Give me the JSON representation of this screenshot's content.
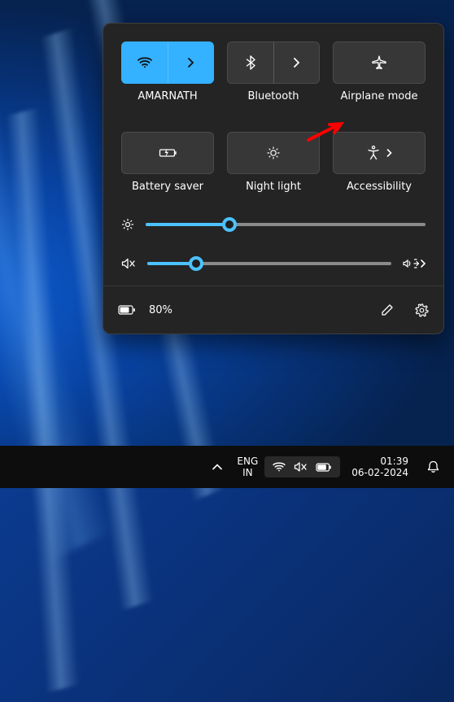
{
  "quick_settings": {
    "tiles": [
      {
        "key": "wifi",
        "label": "AMARNATH",
        "active": true,
        "split": true
      },
      {
        "key": "bluetooth",
        "label": "Bluetooth",
        "active": false,
        "split": true
      },
      {
        "key": "airplane",
        "label": "Airplane mode",
        "active": false,
        "split": false
      },
      {
        "key": "battery_saver",
        "label": "Battery saver",
        "active": false,
        "split": false
      },
      {
        "key": "night_light",
        "label": "Night light",
        "active": false,
        "split": false
      },
      {
        "key": "accessibility",
        "label": "Accessibility",
        "active": false,
        "split": true,
        "inline_chevron": true
      }
    ],
    "brightness_percent": 30,
    "volume_percent": 20,
    "battery_label": "80%"
  },
  "taskbar": {
    "language_primary": "ENG",
    "language_secondary": "IN",
    "time": "01:39",
    "date": "06-02-2024"
  }
}
